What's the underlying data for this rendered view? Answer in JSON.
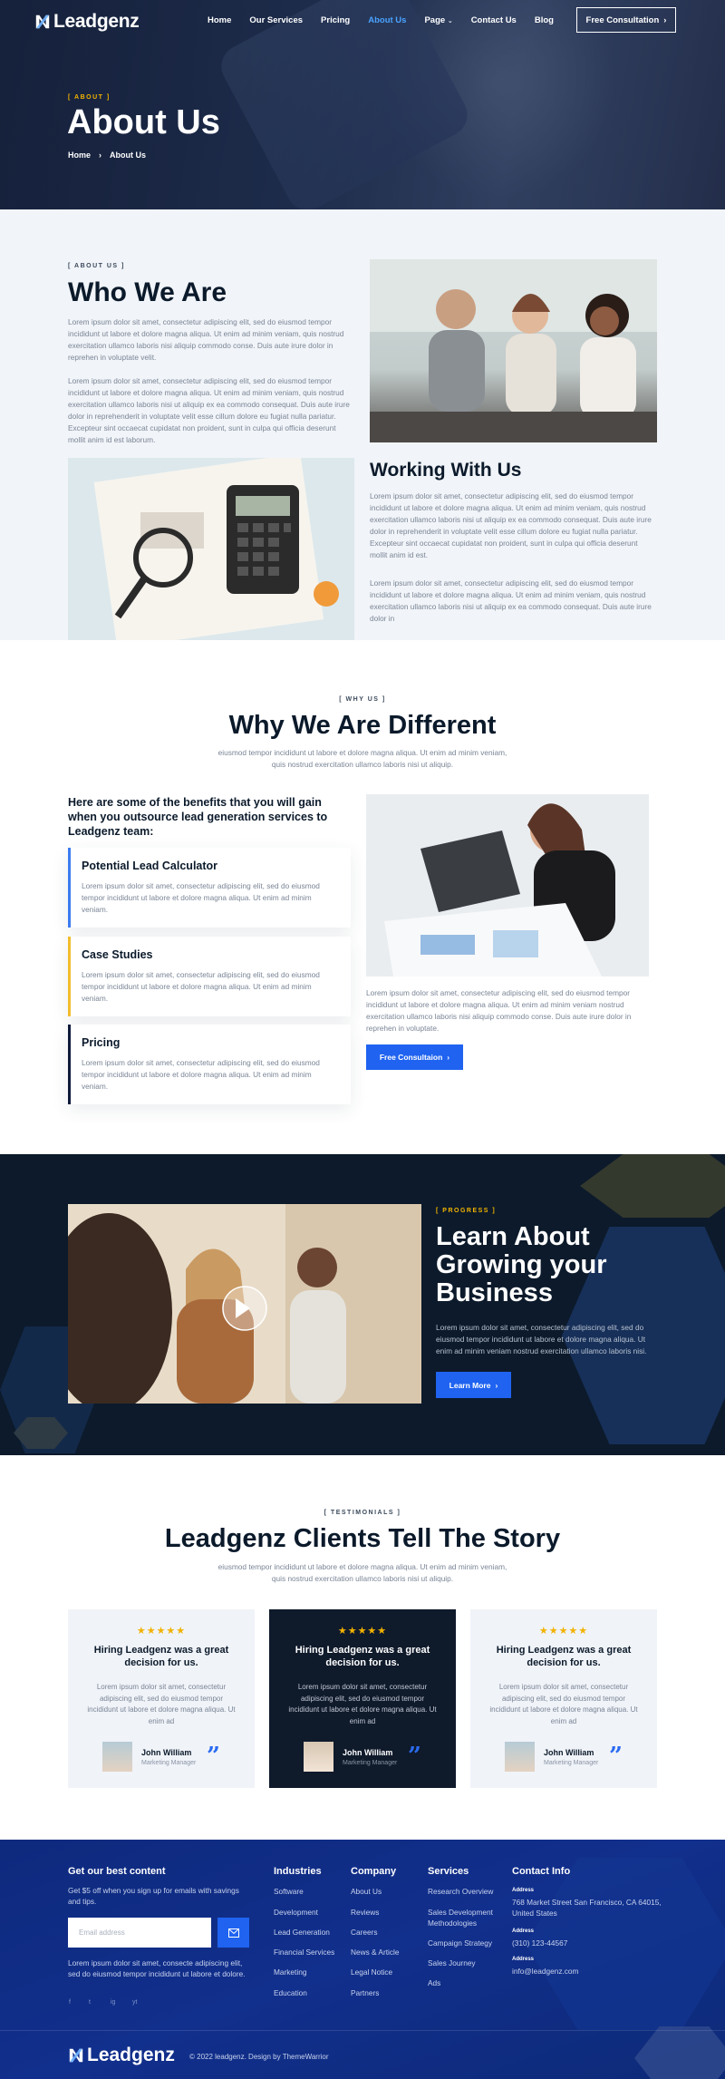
{
  "brand": {
    "name": "Leadgenz"
  },
  "nav": {
    "items": [
      "Home",
      "Our Services",
      "Pricing",
      "About Us",
      "Page",
      "Contact Us",
      "Blog"
    ],
    "active_index": 3,
    "cta": "Free Consultation"
  },
  "hero": {
    "tag": "[ ABOUT ]",
    "title": "About Us",
    "breadcrumb": [
      "Home",
      "About Us"
    ]
  },
  "who": {
    "tag": "[ ABOUT US ]",
    "title": "Who We Are",
    "p1": "Lorem ipsum dolor sit amet, consectetur adipiscing elit, sed do eiusmod tempor incididunt ut labore et dolore magna aliqua. Ut enim ad minim veniam, quis nostrud exercitation ullamco laboris nisi aliquip commodo conse. Duis aute irure dolor in reprehen in voluptate velit.",
    "p2": "Lorem ipsum dolor sit amet, consectetur adipiscing elit, sed do eiusmod tempor incididunt ut labore et dolore magna aliqua. Ut enim ad minim veniam, quis nostrud exercitation ullamco laboris nisi ut aliquip ex ea commodo consequat. Duis aute irure dolor in reprehenderit in voluptate velit esse cillum dolore eu fugiat nulla pariatur. Excepteur sint occaecat cupidatat non proident, sunt in culpa qui officia deserunt mollit anim id est laborum.",
    "work_title": "Working With Us",
    "p3": "Lorem ipsum dolor sit amet, consectetur adipiscing elit, sed do eiusmod tempor incididunt ut labore et dolore magna aliqua. Ut enim ad minim veniam, quis nostrud exercitation ullamco laboris nisi ut aliquip ex ea commodo consequat. Duis aute irure dolor in reprehenderit in voluptate velit esse cillum dolore eu fugiat nulla pariatur. Excepteur sint occaecat cupidatat non proident, sunt in culpa qui officia deserunt mollit anim id est.",
    "p4": "Lorem ipsum dolor sit amet, consectetur adipiscing elit, sed do eiusmod tempor incididunt ut labore et dolore magna aliqua. Ut enim ad minim veniam, quis nostrud exercitation ullamco laboris nisi ut aliquip ex ea commodo consequat. Duis aute irure dolor in"
  },
  "why": {
    "tag": "[ WHY US ]",
    "title": "Why We Are Different",
    "sub": "eiusmod tempor incididunt ut labore et dolore magna aliqua. Ut enim ad minim veniam, quis nostrud exercitation ullamco laboris nisi ut aliquip.",
    "benefits_heading": "Here are some of the benefits that you will gain when you outsource lead generation services to Leadgenz team:",
    "cards": [
      {
        "title": "Potential Lead Calculator",
        "text": "Lorem ipsum dolor sit amet, consectetur adipiscing elit, sed do eiusmod tempor incididunt ut labore et dolore magna aliqua. Ut enim ad minim veniam."
      },
      {
        "title": "Case Studies",
        "text": "Lorem ipsum dolor sit amet, consectetur adipiscing elit, sed do eiusmod tempor incididunt ut labore et dolore magna aliqua. Ut enim ad minim veniam."
      },
      {
        "title": "Pricing",
        "text": "Lorem ipsum dolor sit amet, consectetur adipiscing elit, sed do eiusmod tempor incididunt ut labore et dolore magna aliqua. Ut enim ad minim veniam."
      }
    ],
    "right_text": "Lorem ipsum dolor sit amet, consectetur adipiscing elit, sed do eiusmod tempor incididunt ut labore et dolore magna aliqua. Ut enim ad minim veniam nostrud exercitation ullamco laboris nisi aliquip commodo conse. Duis aute irure dolor in reprehen in voluptate.",
    "cta": "Free Consultaion"
  },
  "progress": {
    "tag": "[ PROGRESS ]",
    "title": "Learn About Growing your Business",
    "text": "Lorem ipsum dolor sit amet, consectetur adipiscing elit, sed do eiusmod tempor incididunt ut labore et dolore magna aliqua. Ut enim ad minim veniam nostrud exercitation ullamco laboris nisi.",
    "cta": "Learn More"
  },
  "testimonials": {
    "tag": "[ TESTIMONIALS ]",
    "title": "Leadgenz Clients Tell The Story",
    "sub": "eiusmod tempor incididunt ut labore et dolore magna aliqua. Ut enim ad minim veniam, quis nostrud exercitation ullamco laboris nisi ut aliquip.",
    "items": [
      {
        "stars": "★★★★★",
        "title": "Hiring Leadgenz was a great decision for us.",
        "text": "Lorem ipsum dolor sit amet, consectetur adipiscing elit, sed do eiusmod tempor incididunt ut labore et dolore magna aliqua. Ut enim ad",
        "name": "John William",
        "role": "Marketing Manager"
      },
      {
        "stars": "★★★★★",
        "title": "Hiring Leadgenz was a great decision for us.",
        "text": "Lorem ipsum dolor sit amet, consectetur adipiscing elit, sed do eiusmod tempor incididunt ut labore et dolore magna aliqua. Ut enim ad",
        "name": "John William",
        "role": "Marketing Manager"
      },
      {
        "stars": "★★★★★",
        "title": "Hiring Leadgenz was a great decision for us.",
        "text": "Lorem ipsum dolor sit amet, consectetur adipiscing elit, sed do eiusmod tempor incididunt ut labore et dolore magna aliqua. Ut enim ad",
        "name": "John William",
        "role": "Marketing Manager"
      }
    ],
    "quote_glyph": "”"
  },
  "footer": {
    "newsletter_title": "Get our best content",
    "newsletter_text": "Get $5 off when you sign up for emails with savings and tips.",
    "email_placeholder": "Email address",
    "bottom_text": "Lorem ipsum dolor sit amet, consecte adipiscing elit, sed do eiusmod tempor incididunt ut labore et dolore.",
    "social": [
      "f",
      "t",
      "ig",
      "yt"
    ],
    "industries": {
      "title": "Industries",
      "links": [
        "Software",
        "Development",
        "Lead Generation",
        "Financial Services",
        "Marketing",
        "Education"
      ]
    },
    "company": {
      "title": "Company",
      "links": [
        "About Us",
        "Reviews",
        "Careers",
        "News & Article",
        "Legal Notice",
        "Partners"
      ]
    },
    "services": {
      "title": "Services",
      "links": [
        "Research Overview",
        "Sales Development Methodologies",
        "Campaign Strategy",
        "Sales Journey",
        "Ads"
      ]
    },
    "contact": {
      "title": "Contact Info",
      "address_label": "Address",
      "address": "768 Market Street San Francisco, CA 64015, United States",
      "phone_label": "Address",
      "phone": "(310) 123-44567",
      "email_label": "Address",
      "email": "info@leadgenz.com"
    },
    "copyright": "© 2022 leadgenz. Design by ThemeWarrior"
  },
  "colors": {
    "accent": "#1f63f0",
    "gold": "#f4b400",
    "dark": "#0c1a2b",
    "footer": "#0e2a7e"
  }
}
